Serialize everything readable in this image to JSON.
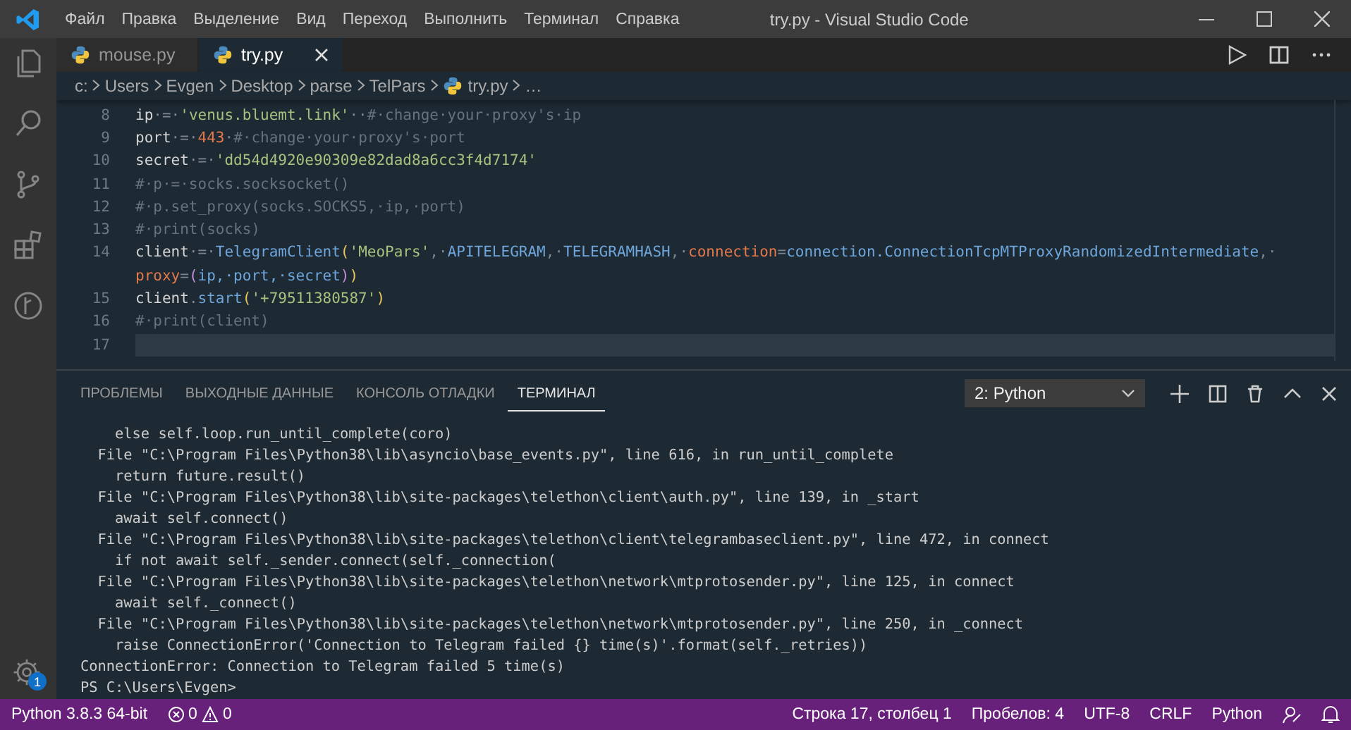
{
  "window": {
    "title": "try.py - Visual Studio Code"
  },
  "menu": [
    "Файл",
    "Правка",
    "Выделение",
    "Вид",
    "Переход",
    "Выполнить",
    "Терминал",
    "Справка"
  ],
  "activity_bar": {
    "items": [
      {
        "kind": "files"
      },
      {
        "kind": "search"
      },
      {
        "kind": "branch"
      },
      {
        "kind": "extensions"
      },
      {
        "kind": "graph"
      }
    ],
    "settings_badge": "1"
  },
  "tabs": [
    {
      "label": "mouse.py",
      "selected": false
    },
    {
      "label": "try.py",
      "selected": true
    }
  ],
  "breadcrumb": [
    {
      "label": "c:",
      "kind": "folder"
    },
    {
      "label": "Users",
      "kind": "folder"
    },
    {
      "label": "Evgen",
      "kind": "folder"
    },
    {
      "label": "Desktop",
      "kind": "folder"
    },
    {
      "label": "parse",
      "kind": "folder"
    },
    {
      "label": "TelPars",
      "kind": "folder"
    },
    {
      "label": "try.py",
      "kind": "file"
    },
    {
      "label": "…",
      "kind": "folder"
    }
  ],
  "editor": {
    "lines": [
      {
        "num": "8",
        "current": false,
        "tokens": [
          {
            "t": "ip",
            "kind": "plain"
          },
          {
            "t": "·=·",
            "kind": "ws"
          },
          {
            "t": "'venus.bluemt.link'",
            "kind": "str"
          },
          {
            "t": "··",
            "kind": "ws"
          },
          {
            "t": "#·change·your·proxy's·ip",
            "kind": "comment"
          }
        ]
      },
      {
        "num": "9",
        "current": false,
        "tokens": [
          {
            "t": "port",
            "kind": "plain"
          },
          {
            "t": "·=·",
            "kind": "ws"
          },
          {
            "t": "443",
            "kind": "num"
          },
          {
            "t": "·",
            "kind": "ws"
          },
          {
            "t": "#·change·your·proxy's·port",
            "kind": "comment"
          }
        ]
      },
      {
        "num": "10",
        "current": false,
        "tokens": [
          {
            "t": "secret",
            "kind": "plain"
          },
          {
            "t": "·=·",
            "kind": "ws"
          },
          {
            "t": "'dd54d4920e90309e82dad8a6cc3f4d7174'",
            "kind": "str"
          }
        ]
      },
      {
        "num": "11",
        "current": false,
        "tokens": [
          {
            "t": "#·p·=·socks.socksocket()",
            "kind": "comment"
          }
        ]
      },
      {
        "num": "12",
        "current": false,
        "tokens": [
          {
            "t": "#·p.set_proxy(socks.SOCKS5,·ip,·port)",
            "kind": "comment"
          }
        ]
      },
      {
        "num": "13",
        "current": false,
        "tokens": [
          {
            "t": "#·print(socks)",
            "kind": "comment"
          }
        ]
      },
      {
        "num": "14",
        "current": false,
        "tokens": [
          {
            "t": "client",
            "kind": "plain"
          },
          {
            "t": "·=·",
            "kind": "ws"
          },
          {
            "t": "TelegramClient",
            "kind": "fn"
          },
          {
            "t": "(",
            "kind": "paren"
          },
          {
            "t": "'MeoPars'",
            "kind": "str"
          },
          {
            "t": ",·",
            "kind": "ws"
          },
          {
            "t": "APITELEGRAM",
            "kind": "fn"
          },
          {
            "t": ",·",
            "kind": "ws"
          },
          {
            "t": "TELEGRAMHASH",
            "kind": "fn"
          },
          {
            "t": ",·",
            "kind": "ws"
          },
          {
            "t": "connection",
            "kind": "param"
          },
          {
            "t": "=",
            "kind": "ws"
          },
          {
            "t": "connection.ConnectionTcpMTProxyRandomizedIntermediate",
            "kind": "fn"
          },
          {
            "t": ",·",
            "kind": "ws"
          }
        ]
      },
      {
        "current": false,
        "tokens": [
          {
            "t": "proxy",
            "kind": "param"
          },
          {
            "t": "=",
            "kind": "ws"
          },
          {
            "t": "(",
            "kind": "paren2"
          },
          {
            "t": "ip,·port,·secret",
            "kind": "fn"
          },
          {
            "t": ")",
            "kind": "paren2"
          },
          {
            "t": ")",
            "kind": "paren"
          }
        ]
      },
      {
        "num": "15",
        "current": false,
        "tokens": [
          {
            "t": "client",
            "kind": "plain"
          },
          {
            "t": ".",
            "kind": "ws"
          },
          {
            "t": "start",
            "kind": "fn"
          },
          {
            "t": "(",
            "kind": "paren"
          },
          {
            "t": "'+79511380587'",
            "kind": "str"
          },
          {
            "t": ")",
            "kind": "paren"
          }
        ]
      },
      {
        "num": "16",
        "current": false,
        "tokens": [
          {
            "t": "#·print(client)",
            "kind": "comment"
          }
        ]
      },
      {
        "num": "17",
        "current": true
      }
    ]
  },
  "panel": {
    "tabs": [
      {
        "label": "ПРОБЛЕМЫ",
        "selected": false
      },
      {
        "label": "ВЫХОДНЫЕ ДАННЫЕ",
        "selected": false
      },
      {
        "label": "КОНСОЛЬ ОТЛАДКИ",
        "selected": false
      },
      {
        "label": "ТЕРМИНАЛ",
        "selected": true
      }
    ],
    "terminal_select": "2: Python",
    "terminal_lines": [
      "    else self.loop.run_until_complete(coro)",
      "  File \"C:\\Program Files\\Python38\\lib\\asyncio\\base_events.py\", line 616, in run_until_complete",
      "    return future.result()",
      "  File \"C:\\Program Files\\Python38\\lib\\site-packages\\telethon\\client\\auth.py\", line 139, in _start",
      "    await self.connect()",
      "  File \"C:\\Program Files\\Python38\\lib\\site-packages\\telethon\\client\\telegrambaseclient.py\", line 472, in connect",
      "    if not await self._sender.connect(self._connection(",
      "  File \"C:\\Program Files\\Python38\\lib\\site-packages\\telethon\\network\\mtprotosender.py\", line 125, in connect",
      "    await self._connect()",
      "  File \"C:\\Program Files\\Python38\\lib\\site-packages\\telethon\\network\\mtprotosender.py\", line 250, in _connect",
      "    raise ConnectionError('Connection to Telegram failed {} time(s)'.format(self._retries))",
      "ConnectionError: Connection to Telegram failed 5 time(s)",
      "PS C:\\Users\\Evgen>"
    ]
  },
  "status_bar": {
    "interpreter": "Python 3.8.3 64-bit",
    "errors": "0",
    "warnings": "0",
    "position": "Строка 17, столбец 1",
    "indent": "Пробелов: 4",
    "encoding": "UTF-8",
    "eol": "CRLF",
    "language": "Python"
  }
}
